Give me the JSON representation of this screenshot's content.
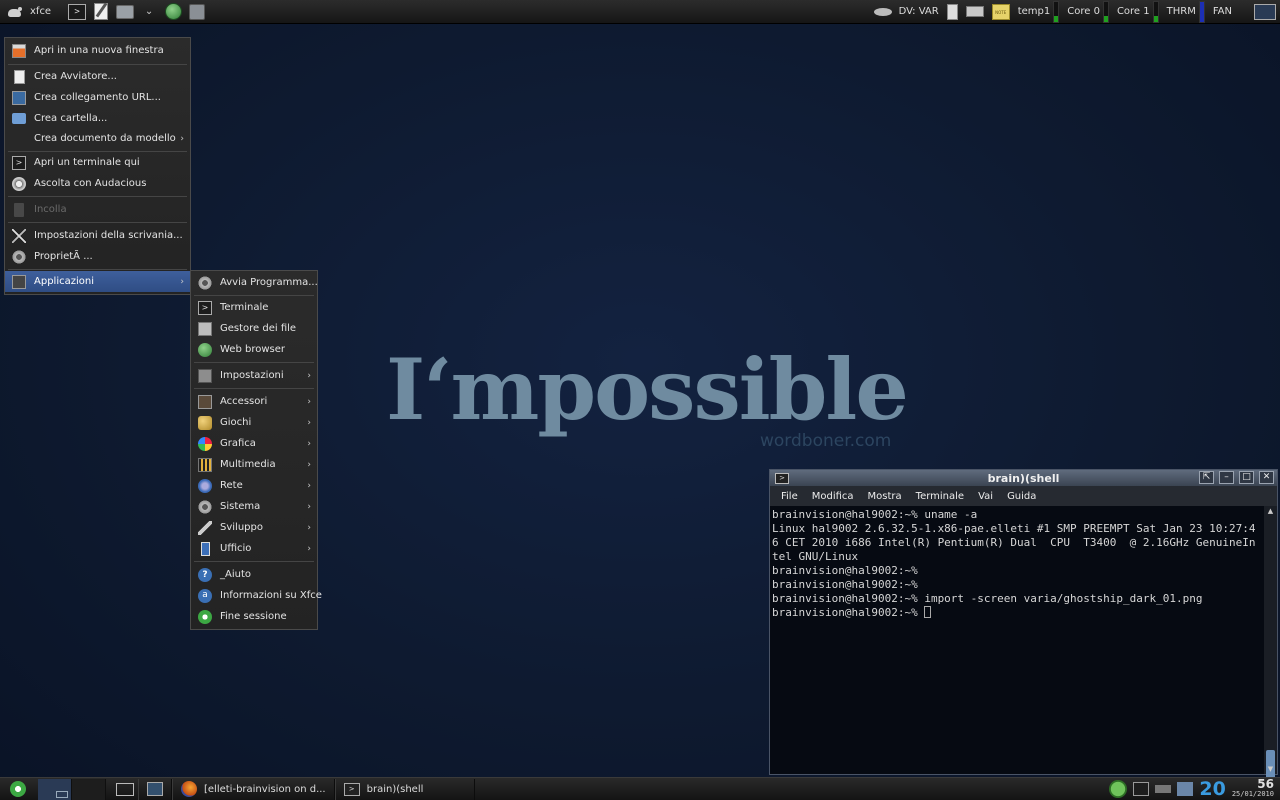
{
  "top_panel": {
    "menu_label": "xfce",
    "launchers": [
      "terminal-icon",
      "text-editor-icon",
      "printer-icon",
      "chevron-down-icon",
      "web-browser-icon",
      "drive-icon"
    ],
    "dvd_label": "DV: VAR",
    "sensors": [
      {
        "label": "temp1",
        "color": "#1fa11f",
        "level": 0.3
      },
      {
        "label": "Core 0",
        "color": "#1fa11f",
        "level": 0.3
      },
      {
        "label": "Core 1",
        "color": "#1fa11f",
        "level": 0.3
      },
      {
        "label": "THRM",
        "color": "#1c2fb5",
        "level": 1.0
      },
      {
        "label": "FAN",
        "color": "",
        "level": 0
      }
    ]
  },
  "wallpaper": {
    "title": "I‘mpossible",
    "subtitle": "wordboner.com"
  },
  "desktop_menu": {
    "items": [
      {
        "label": "Apri in una nuova finestra",
        "icon": "window-icon"
      },
      {
        "label": "Crea Avviatore...",
        "icon": "document-icon"
      },
      {
        "label": "Crea collegamento URL...",
        "icon": "link-icon"
      },
      {
        "label": "Crea cartella...",
        "icon": "folder-icon"
      },
      {
        "label": "Crea documento da modello",
        "icon": "",
        "submenu": true
      },
      {
        "label": "Apri un terminale qui",
        "icon": "terminal-icon"
      },
      {
        "label": "Ascolta con Audacious",
        "icon": "audacious-icon"
      },
      {
        "label": "Incolla",
        "icon": "trash-icon",
        "disabled": true
      },
      {
        "label": "Impostazioni della scrivania...",
        "icon": "tools-icon"
      },
      {
        "label": "ProprietÃ ...",
        "icon": "gear-icon"
      },
      {
        "label": "Applicazioni",
        "icon": "applications-icon",
        "submenu": true,
        "active": true
      }
    ]
  },
  "applications_menu": {
    "items": [
      {
        "label": "Avvia Programma...",
        "icon": "gear-icon"
      },
      {
        "label": "Terminale",
        "icon": "terminal-icon"
      },
      {
        "label": "Gestore dei file",
        "icon": "file-manager-icon"
      },
      {
        "label": "Web browser",
        "icon": "web-browser-icon"
      },
      {
        "label": "Impostazioni",
        "icon": "settings-icon",
        "submenu": true
      },
      {
        "label": "Accessori",
        "icon": "accessories-icon",
        "submenu": true
      },
      {
        "label": "Giochi",
        "icon": "games-icon",
        "submenu": true
      },
      {
        "label": "Grafica",
        "icon": "graphics-icon",
        "submenu": true
      },
      {
        "label": "Multimedia",
        "icon": "multimedia-icon",
        "submenu": true
      },
      {
        "label": "Rete",
        "icon": "network-icon",
        "submenu": true
      },
      {
        "label": "Sistema",
        "icon": "system-icon",
        "submenu": true
      },
      {
        "label": "Sviluppo",
        "icon": "development-icon",
        "submenu": true
      },
      {
        "label": "Ufficio",
        "icon": "office-icon",
        "submenu": true
      },
      {
        "label": "_Aiuto",
        "icon": "help-icon"
      },
      {
        "label": "Informazioni su Xfce",
        "icon": "about-icon"
      },
      {
        "label": "Fine sessione",
        "icon": "logout-icon"
      }
    ]
  },
  "terminal": {
    "title": "brain)(shell",
    "menu": [
      "File",
      "Modifica",
      "Mostra",
      "Terminale",
      "Vai",
      "Guida"
    ],
    "lines": [
      "brainvision@hal9002:~% uname -a",
      "Linux hal9002 2.6.32.5-1.x86-pae.elleti #1 SMP PREEMPT Sat Jan 23 10:27:46 CET 2010 i686 Intel(R) Pentium(R) Dual  CPU  T3400  @ 2.16GHz GenuineIntel GNU/Linux",
      "brainvision@hal9002:~%",
      "brainvision@hal9002:~%",
      "brainvision@hal9002:~% import -screen varia/ghostship_dark_01.png",
      "brainvision@hal9002:~% "
    ]
  },
  "bottom_panel": {
    "tasks": [
      {
        "label": "[elleti-brainvision on d...",
        "icon": "firefox-icon"
      },
      {
        "label": "brain)(shell",
        "icon": "terminal-icon"
      }
    ],
    "clock": {
      "hour": "20",
      "minute": "56",
      "date": "25/01/2010"
    }
  },
  "colors": {
    "accent": "#3a9be0",
    "menu_active": "#3e5f9c",
    "wallpaper_text": "#6f8ba0"
  }
}
